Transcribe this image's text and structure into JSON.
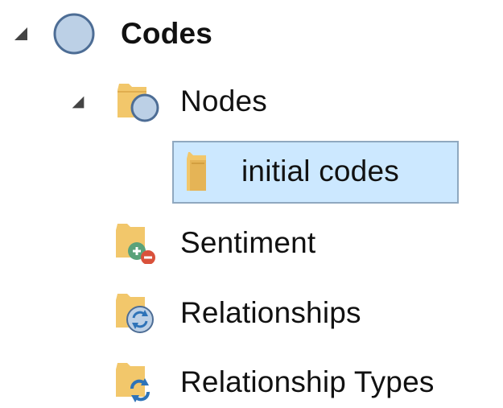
{
  "tree": {
    "root": {
      "label": "Codes",
      "expanded": true,
      "icon": "circle-codes-icon"
    },
    "nodes": {
      "label": "Nodes",
      "expanded": true,
      "icon": "folder-circle-icon"
    },
    "initial_codes": {
      "label": "initial codes",
      "selected": true,
      "icon": "folder-icon"
    },
    "sentiment": {
      "label": "Sentiment",
      "icon": "sentiment-folder-icon"
    },
    "relationships": {
      "label": "Relationships",
      "icon": "relationships-folder-icon"
    },
    "relationship_types": {
      "label": "Relationship Types",
      "icon": "relationship-types-folder-icon"
    }
  },
  "colors": {
    "selection_fill": "#cce8ff",
    "selection_border": "#8fa8c0",
    "folder": "#f2c76b",
    "node_circle": "#bcd0e6"
  }
}
